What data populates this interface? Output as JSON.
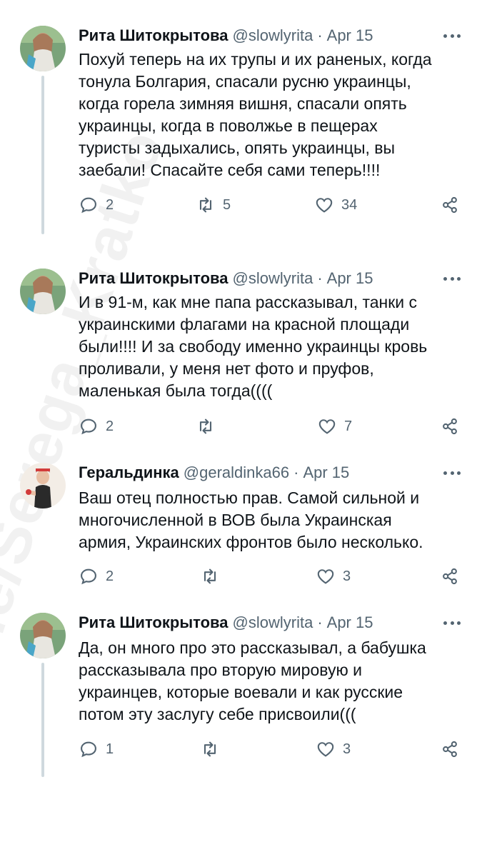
{
  "watermark": "t.me/Serega_Kratko",
  "tweets": [
    {
      "name": "Рита Шитокрытова",
      "handle": "@slowlyrita",
      "separator": "·",
      "date": "Apr 15",
      "text": "Похуй теперь на их трупы и их раненых, когда\nтонула Болгария, спасали русню украинцы,\nкогда горела зимняя вишня, спасали опять\nукраинцы, когда в поволжье в пещерах\nтуристы задыхались, опять украинцы, вы\nзаебали! Спасайте себя сами теперь!!!!",
      "replies": "2",
      "retweets": "5",
      "likes": "34"
    },
    {
      "name": "Рита Шитокрытова",
      "handle": "@slowlyrita",
      "separator": "·",
      "date": "Apr 15",
      "text": "И в 91-м, как мне папа рассказывал, танки с\nукраинскими флагами на красной площади\nбыли!!!! И за свободу именно украинцы кровь\nпроливали, у меня нет фото и пруфов,\nмаленькая была тогда((((",
      "replies": "2",
      "retweets": "",
      "likes": "7"
    },
    {
      "name": "Геральдинка",
      "handle": "@geraldinka66",
      "separator": "·",
      "date": "Apr 15",
      "text": "Ваш отец полностью прав. Самой сильной и\nмногочисленной в ВОВ была Украинская\nармия, Украинских фронтов было несколько.",
      "replies": "2",
      "retweets": "",
      "likes": "3"
    },
    {
      "name": "Рита Шитокрытова",
      "handle": "@slowlyrita",
      "separator": "·",
      "date": "Apr 15",
      "text": "Да, он много про это рассказывал, а бабушка\nрассказывала про вторую мировую и\nукраинцев, которые воевали и как русские\nпотом эту заслугу себе присвоили(((",
      "replies": "1",
      "retweets": "",
      "likes": "3"
    }
  ],
  "icons": {
    "reply": "reply-icon",
    "retweet": "retweet-icon",
    "like": "like-icon",
    "share": "share-icon",
    "more": "more-icon"
  },
  "colors": {
    "text": "#0f1419",
    "secondary": "#536471",
    "thread_line": "#cfd9de"
  }
}
